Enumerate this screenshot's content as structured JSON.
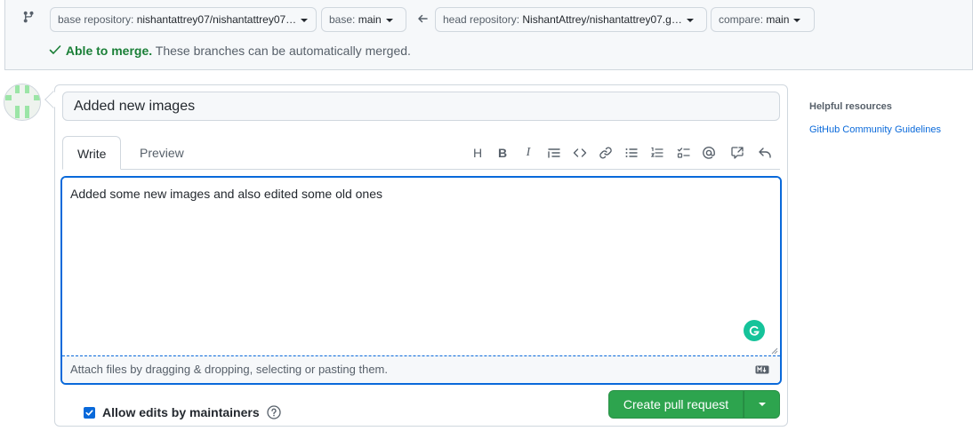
{
  "compare": {
    "base_repo_label": "base repository: ",
    "base_repo_value": "nishantattrey07/nishantattrey07…",
    "base_label": "base: ",
    "base_value": "main",
    "head_repo_label": "head repository: ",
    "head_repo_value": "NishantAttrey/nishantattrey07.g…",
    "compare_label": "compare: ",
    "compare_value": "main",
    "merge_status": "Able to merge.",
    "merge_message": " These branches can be automatically merged."
  },
  "pr": {
    "title_value": "Added new images",
    "tabs": [
      {
        "label": "Write"
      },
      {
        "label": "Preview"
      }
    ],
    "toolbar": [
      {
        "icon": "heading-icon",
        "glyph": "H"
      },
      {
        "icon": "bold-icon",
        "glyph": "B"
      },
      {
        "icon": "italic-icon",
        "glyph": "I"
      },
      {
        "icon": "quote-icon"
      },
      {
        "icon": "code-icon"
      },
      {
        "icon": "link-icon"
      },
      {
        "icon": "bulleted-list-icon"
      },
      {
        "icon": "numbered-list-icon"
      },
      {
        "icon": "task-list-icon"
      },
      {
        "icon": "mention-icon"
      },
      {
        "icon": "cross-reference-icon"
      },
      {
        "icon": "reply-icon"
      }
    ],
    "body_value": "Added some new images and also edited some old ones",
    "attach_hint": "Attach files by dragging & dropping, selecting or pasting them.",
    "allow_edits_label": "Allow edits by maintainers",
    "allow_edits_checked": true,
    "create_label": "Create pull request"
  },
  "sidebar": {
    "title": "Helpful resources",
    "link": "GitHub Community Guidelines"
  },
  "colors": {
    "accent": "#0969da",
    "success": "#1a7f37",
    "button": "#2da44e",
    "grammarly": "#15c39a"
  }
}
